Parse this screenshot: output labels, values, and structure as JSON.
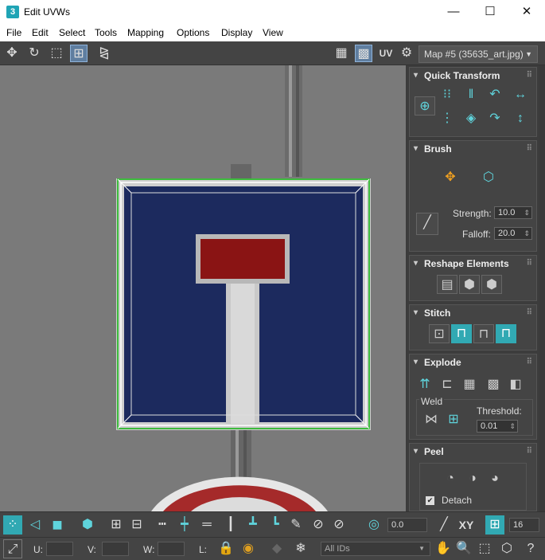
{
  "window": {
    "app_icon": "3",
    "title": "Edit UVWs",
    "minimize": "—",
    "maximize": "☐",
    "close": "✕"
  },
  "menu": [
    "File",
    "Edit",
    "Select",
    "Tools",
    "Mapping",
    "Options",
    "Display",
    "View"
  ],
  "toolbar": {
    "uv_label": "UV",
    "map_selector": "Map #5 (35635_art.jpg)"
  },
  "panel": {
    "quick_transform": {
      "title": "Quick Transform"
    },
    "brush": {
      "title": "Brush",
      "strength_label": "Strength:",
      "strength_value": "10.0",
      "falloff_label": "Falloff:",
      "falloff_value": "20.0"
    },
    "reshape": {
      "title": "Reshape Elements"
    },
    "stitch": {
      "title": "Stitch"
    },
    "explode": {
      "title": "Explode",
      "weld_label": "Weld",
      "threshold_label": "Threshold:",
      "threshold_value": "0.01"
    },
    "peel": {
      "title": "Peel",
      "detach_label": "Detach",
      "detach_checked": true
    }
  },
  "bottom": {
    "angle_value": "0.0",
    "xy_label": "XY",
    "grid_value": "16",
    "u_label": "U:",
    "v_label": "V:",
    "w_label": "W:",
    "l_label": "L:",
    "ids_value": "All IDs"
  },
  "colors": {
    "accent": "#31a9b3",
    "sign_blue": "#1c2a5e",
    "sign_red": "#8a1414",
    "selection_green": "#3dbb3d"
  }
}
